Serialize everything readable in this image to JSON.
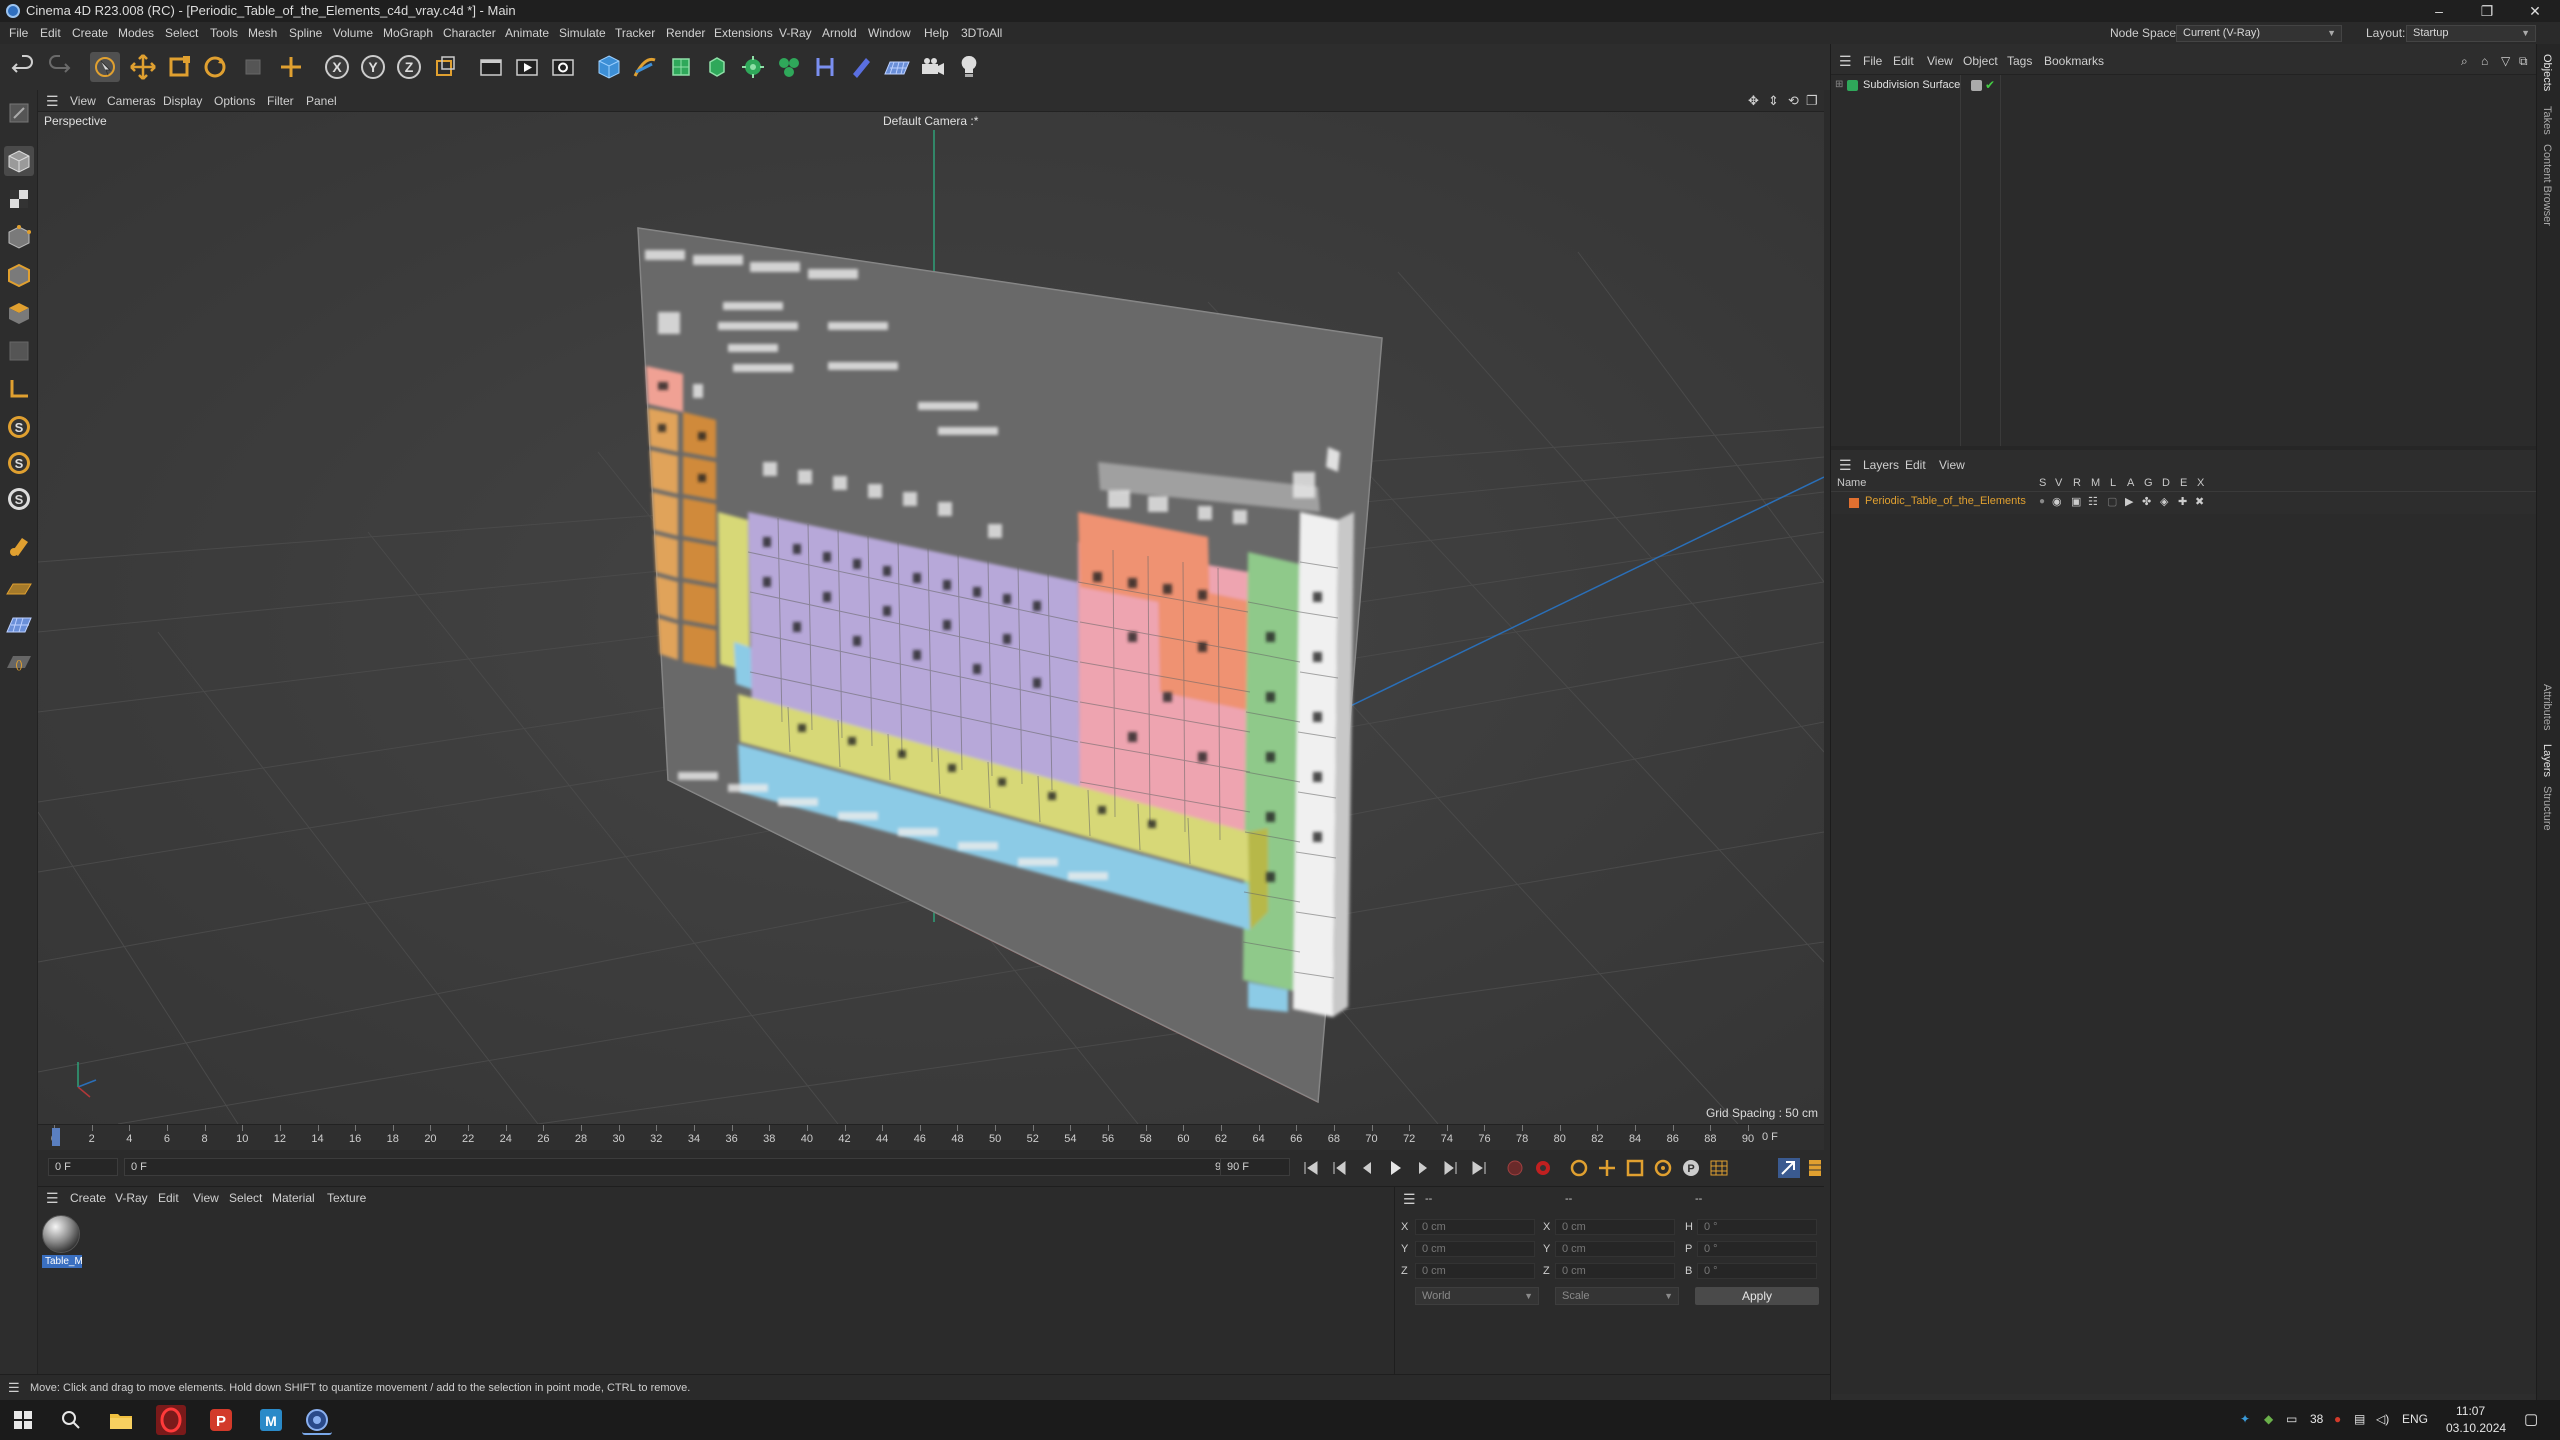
{
  "window": {
    "title": "Cinema 4D R23.008 (RC) - [Periodic_Table_of_the_Elements_c4d_vray.c4d *] - Main",
    "controls": [
      "–",
      "❐",
      "✕"
    ]
  },
  "menubar": {
    "items": [
      "File",
      "Edit",
      "Create",
      "Modes",
      "Select",
      "Tools",
      "Mesh",
      "Spline",
      "Volume",
      "MoGraph",
      "Character",
      "Animate",
      "Simulate",
      "Tracker",
      "Render",
      "Extensions",
      "V-Ray",
      "Arnold",
      "Window",
      "Help",
      "3DToAll"
    ],
    "node_space_label": "Node Space:",
    "node_space_value": "Current (V-Ray)",
    "layout_label": "Layout:",
    "layout_value": "Startup"
  },
  "toolbar": {
    "icons": [
      "undo-icon",
      "redo-icon",
      "live-selection-icon",
      "move-icon",
      "scale-icon",
      "rotate-icon",
      "recent-tools-icon",
      "create-icon",
      "x-axis-icon",
      "y-axis-icon",
      "z-axis-icon",
      "coordinate-system-icon",
      "render-region-icon",
      "render-view-icon",
      "render-settings-icon",
      "cube-icon",
      "pen-icon",
      "subdivision-icon",
      "extrude-icon",
      "array-icon",
      "instance-icon",
      "deformer-icon",
      "field-icon",
      "floor-icon",
      "camera-icon",
      "light-icon"
    ]
  },
  "left_palette": {
    "icons": [
      "make-editable-icon",
      "model-mode-icon",
      "texture-mode-icon",
      "points-mode-icon",
      "edges-mode-icon",
      "polygons-mode-icon",
      "uv-mode-icon",
      "axis-icon",
      "snap-icon",
      "soft-selection-icon",
      "symmetry-icon",
      "paint-icon",
      "workplane-icon",
      "quantize-icon",
      "solo-icon"
    ]
  },
  "viewport": {
    "menus": [
      "View",
      "Cameras",
      "Display",
      "Options",
      "Filter",
      "Panel"
    ],
    "projection": "Perspective",
    "camera": "Default Camera :*",
    "grid_spacing": "Grid Spacing : 50 cm",
    "colors": {
      "background": "#3b3b3b",
      "red": "#f0a194",
      "orange": "#e0a35a",
      "yellow": "#d7d877",
      "purple": "#b7a8d9",
      "pink": "#eea4b0",
      "salmon": "#ef9272",
      "green": "#8fc98a",
      "white": "#f0f0f0",
      "blue": "#8ccbe6",
      "axis_y": "#2fa078",
      "axis_x": "#b03838",
      "axis_z": "#2a6fb8"
    }
  },
  "timeline": {
    "ticks": [
      "0",
      "2",
      "4",
      "6",
      "8",
      "10",
      "12",
      "14",
      "16",
      "18",
      "20",
      "22",
      "24",
      "26",
      "28",
      "30",
      "32",
      "34",
      "36",
      "38",
      "40",
      "42",
      "44",
      "46",
      "48",
      "50",
      "52",
      "54",
      "56",
      "58",
      "60",
      "62",
      "64",
      "66",
      "68",
      "70",
      "72",
      "74",
      "76",
      "78",
      "80",
      "82",
      "84",
      "86",
      "88",
      "90"
    ],
    "current_frame": "0 F"
  },
  "transport": {
    "start_field": "0 F",
    "preview_start": "0 F",
    "preview_end": "90 F",
    "end_field": "90 F"
  },
  "material_manager": {
    "menus": [
      "Create",
      "V-Ray",
      "Edit",
      "View",
      "Select",
      "Material",
      "Texture"
    ],
    "materials": [
      {
        "label": "Table_M"
      }
    ]
  },
  "coord_manager": {
    "col_headers": [
      "--",
      "--",
      "--"
    ],
    "rows": [
      {
        "a_label": "X",
        "a_value": "0 cm",
        "b_label": "X",
        "b_value": "0 cm",
        "c_label": "H",
        "c_value": "0 °"
      },
      {
        "a_label": "Y",
        "a_value": "0 cm",
        "b_label": "Y",
        "b_value": "0 cm",
        "c_label": "P",
        "c_value": "0 °"
      },
      {
        "a_label": "Z",
        "a_value": "0 cm",
        "b_label": "Z",
        "b_value": "0 cm",
        "c_label": "B",
        "c_value": "0 °"
      }
    ],
    "space_select": "World",
    "mode_select": "Scale",
    "apply_label": "Apply"
  },
  "status": {
    "text": "Move: Click and drag to move elements. Hold down SHIFT to quantize movement / add to the selection in point mode, CTRL to remove."
  },
  "object_manager": {
    "menus": [
      "File",
      "Edit",
      "View",
      "Object",
      "Tags",
      "Bookmarks"
    ],
    "objects": [
      {
        "name": "Subdivision Surface"
      }
    ]
  },
  "layer_manager": {
    "menus": [
      "Layers",
      "Edit",
      "View"
    ],
    "columns": [
      "Name",
      "S",
      "V",
      "R",
      "M",
      "L",
      "A",
      "G",
      "D",
      "E",
      "X"
    ],
    "layers": [
      {
        "name": "Periodic_Table_of_the_Elements",
        "color": "#e07030"
      }
    ]
  },
  "right_tabs": {
    "top": [
      "Objects",
      "Takes",
      "Content Browser"
    ],
    "bottom": [
      "Attributes",
      "Layers",
      "Structure"
    ]
  },
  "taskbar": {
    "apps": [
      "windows-start-icon",
      "search-icon",
      "file-explorer-icon",
      "opera-icon",
      "wps-presentation-icon",
      "malwarebytes-icon",
      "cinema4d-icon"
    ],
    "tray_temp": "38",
    "language": "ENG",
    "time": "11:07",
    "date": "03.10.2024"
  }
}
